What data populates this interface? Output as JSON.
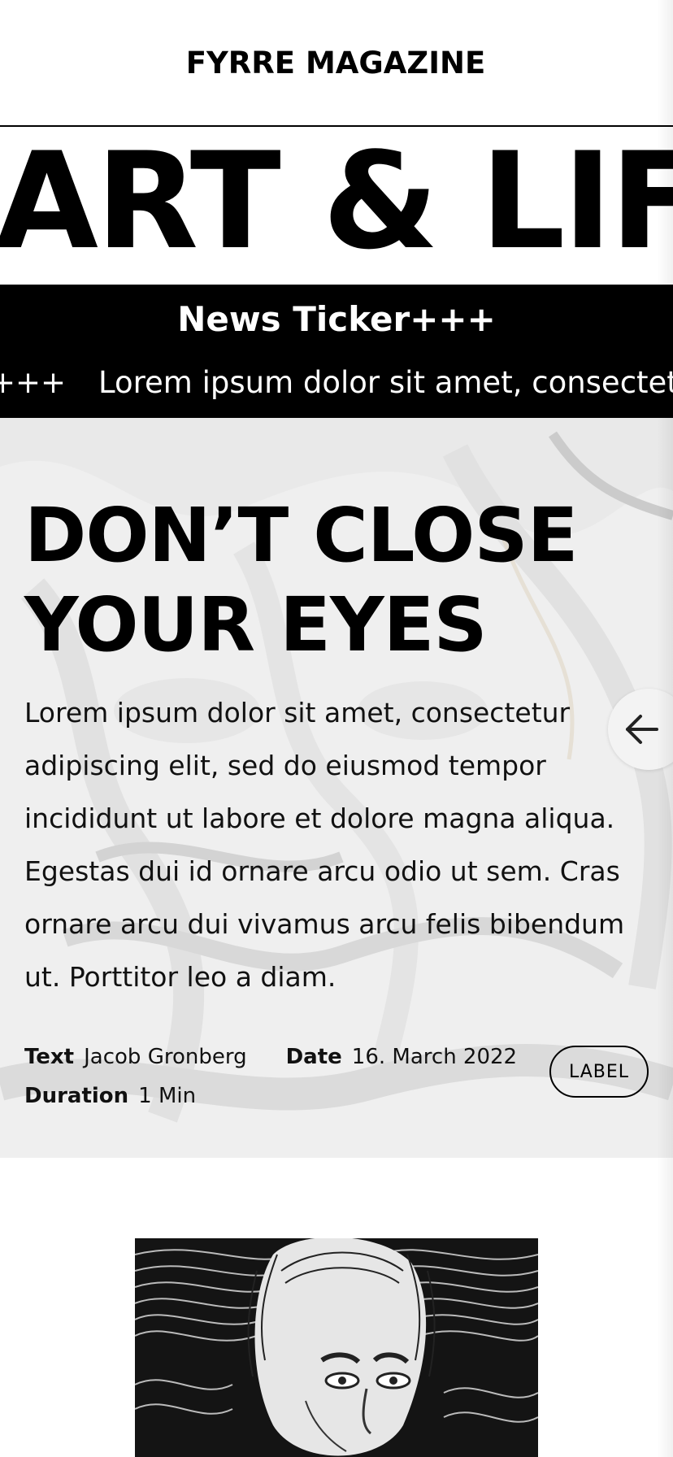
{
  "header": {
    "brand": "FYRRE MAGAZINE"
  },
  "section": {
    "title": "ART & LIFE"
  },
  "ticker": {
    "heading": "News Ticker+++",
    "separator": "+++",
    "text": "Lorem ipsum dolor sit amet, consectetur"
  },
  "hero": {
    "headline_line1": "DON’T CLOSE",
    "headline_line2": "YOUR EYES",
    "body": "Lorem ipsum dolor sit amet, consectetur adipiscing elit, sed do eiusmod tempor incididunt ut labore et dolore magna aliqua. Egestas dui id ornare arcu odio ut sem. Cras ornare arcu dui vivamus arcu felis bibendum ut. Porttitor leo a diam.",
    "meta": {
      "text_label": "Text",
      "text_value": "Jacob Gronberg",
      "date_label": "Date",
      "date_value": "16. March 2022",
      "duration_label": "Duration",
      "duration_value": "1 Min"
    },
    "chip_label": "LABEL",
    "back_icon": "arrow-left-icon"
  },
  "colors": {
    "text": "#000000",
    "ticker_bg": "#000000",
    "ticker_text": "#ffffff",
    "page_bg": "#ffffff"
  }
}
